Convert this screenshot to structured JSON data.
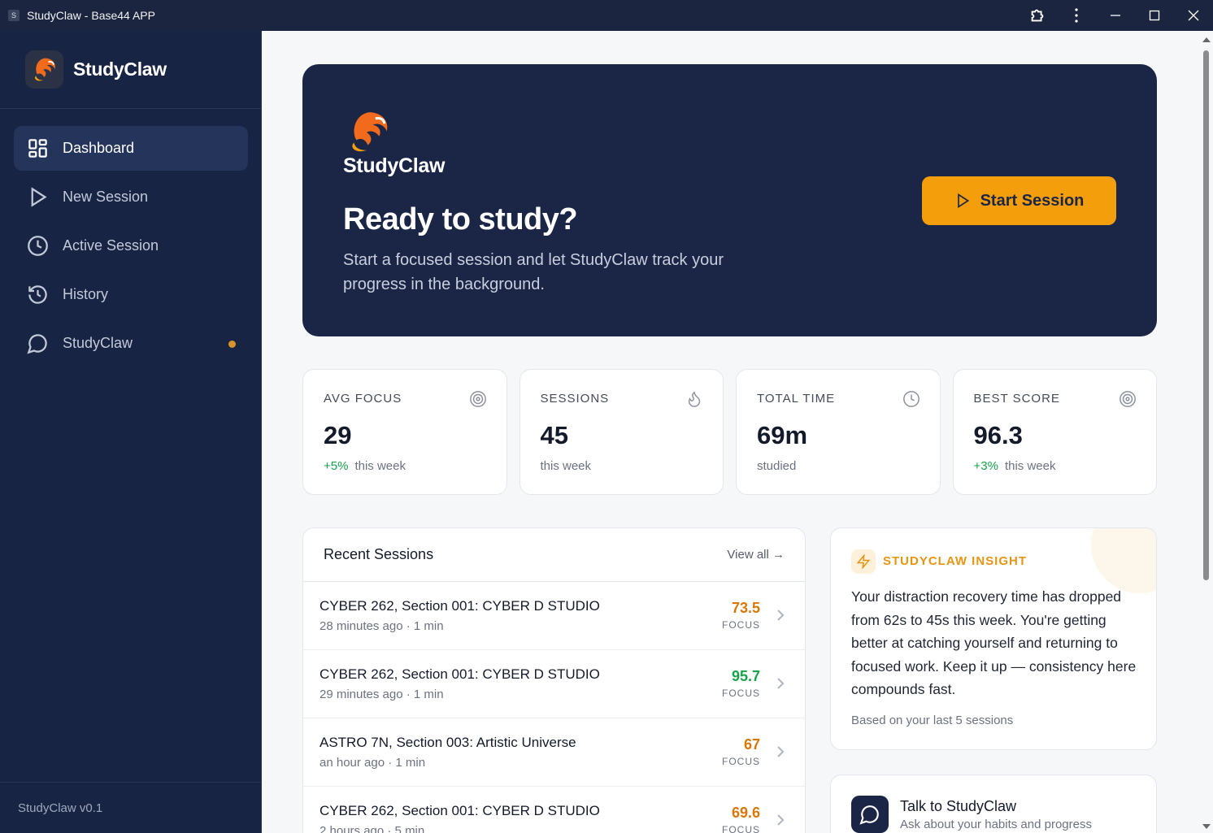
{
  "window": {
    "title": "StudyClaw - Base44 APP",
    "app_icon_letter": "S"
  },
  "sidebar": {
    "brand": "StudyClaw",
    "items": [
      {
        "label": "Dashboard",
        "icon": "dashboard-icon",
        "active": true
      },
      {
        "label": "New Session",
        "icon": "play-icon"
      },
      {
        "label": "Active Session",
        "icon": "clock-icon"
      },
      {
        "label": "History",
        "icon": "history-icon"
      },
      {
        "label": "StudyClaw",
        "icon": "chat-icon",
        "badge_dot": true
      }
    ],
    "footer": "StudyClaw v0.1"
  },
  "hero": {
    "brand": "StudyClaw",
    "title": "Ready to study?",
    "subtitle": "Start a focused session and let StudyClaw track your progress in the background.",
    "button": "Start Session"
  },
  "stats": [
    {
      "label": "AVG FOCUS",
      "value": "29",
      "delta": "+5%",
      "sub": "this week",
      "icon": "target-icon"
    },
    {
      "label": "SESSIONS",
      "value": "45",
      "delta": "",
      "sub": "this week",
      "icon": "flame-icon"
    },
    {
      "label": "TOTAL TIME",
      "value": "69m",
      "delta": "",
      "sub": "studied",
      "icon": "clock-icon"
    },
    {
      "label": "BEST SCORE",
      "value": "96.3",
      "delta": "+3%",
      "sub": "this week",
      "icon": "target-icon"
    }
  ],
  "recent": {
    "title": "Recent Sessions",
    "view_all": "View all →",
    "score_label": "FOCUS",
    "rows": [
      {
        "title": "CYBER 262, Section 001: CYBER D STUDIO",
        "meta": "28 minutes ago · 1 min",
        "score": "73.5",
        "color": "#d97706"
      },
      {
        "title": "CYBER 262, Section 001: CYBER D STUDIO",
        "meta": "29 minutes ago · 1 min",
        "score": "95.7",
        "color": "#16a34a"
      },
      {
        "title": "ASTRO 7N, Section 003: Artistic Universe",
        "meta": "an hour ago · 1 min",
        "score": "67",
        "color": "#d97706"
      },
      {
        "title": "CYBER 262, Section 001: CYBER D STUDIO",
        "meta": "2 hours ago · 5 min",
        "score": "69.6",
        "color": "#d97706"
      }
    ]
  },
  "insight": {
    "label": "STUDYCLAW INSIGHT",
    "text": "Your distraction recovery time has dropped from 62s to 45s this week. You're getting better at catching yourself and returning to focused work. Keep it up — consistency here compounds fast.",
    "footer": "Based on your last 5 sessions"
  },
  "talk": {
    "title": "Talk to StudyClaw",
    "subtitle": "Ask about your habits and progress"
  },
  "colors": {
    "accent": "#f59e0b",
    "navy": "#1b2646",
    "sidebar": "#182444",
    "positive": "#16a34a",
    "warning": "#d97706"
  }
}
